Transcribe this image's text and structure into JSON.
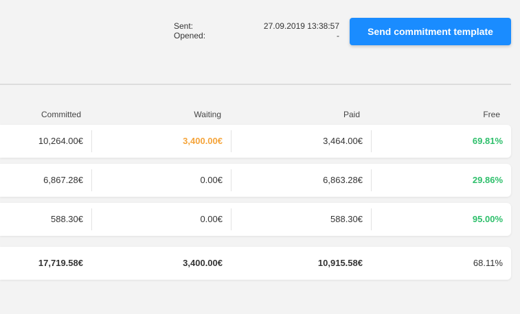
{
  "status": {
    "sent_label": "Sent:",
    "sent_value": "27.09.2019 13:38:57",
    "opened_label": "Opened:",
    "opened_value": "-"
  },
  "send_button": {
    "label": "Send commitment template"
  },
  "table": {
    "headers": [
      "Committed",
      "Waiting",
      "Paid",
      "Free"
    ],
    "rows": [
      {
        "committed": "10,264.00€",
        "waiting": "3,400.00€",
        "paid": "3,464.00€",
        "free": "69.81%"
      },
      {
        "committed": "6,867.28€",
        "waiting": "0.00€",
        "paid": "6,863.28€",
        "free": "29.86%"
      },
      {
        "committed": "588.30€",
        "waiting": "0.00€",
        "paid": "588.30€",
        "free": "95.00%"
      }
    ],
    "total": {
      "committed": "17,719.58€",
      "waiting": "3,400.00€",
      "paid": "10,915.58€",
      "free": "68.11%"
    }
  },
  "colors": {
    "accent": "#1a8cff",
    "waiting_highlight": "#f5a43a",
    "free_positive": "#2ebf6b"
  }
}
